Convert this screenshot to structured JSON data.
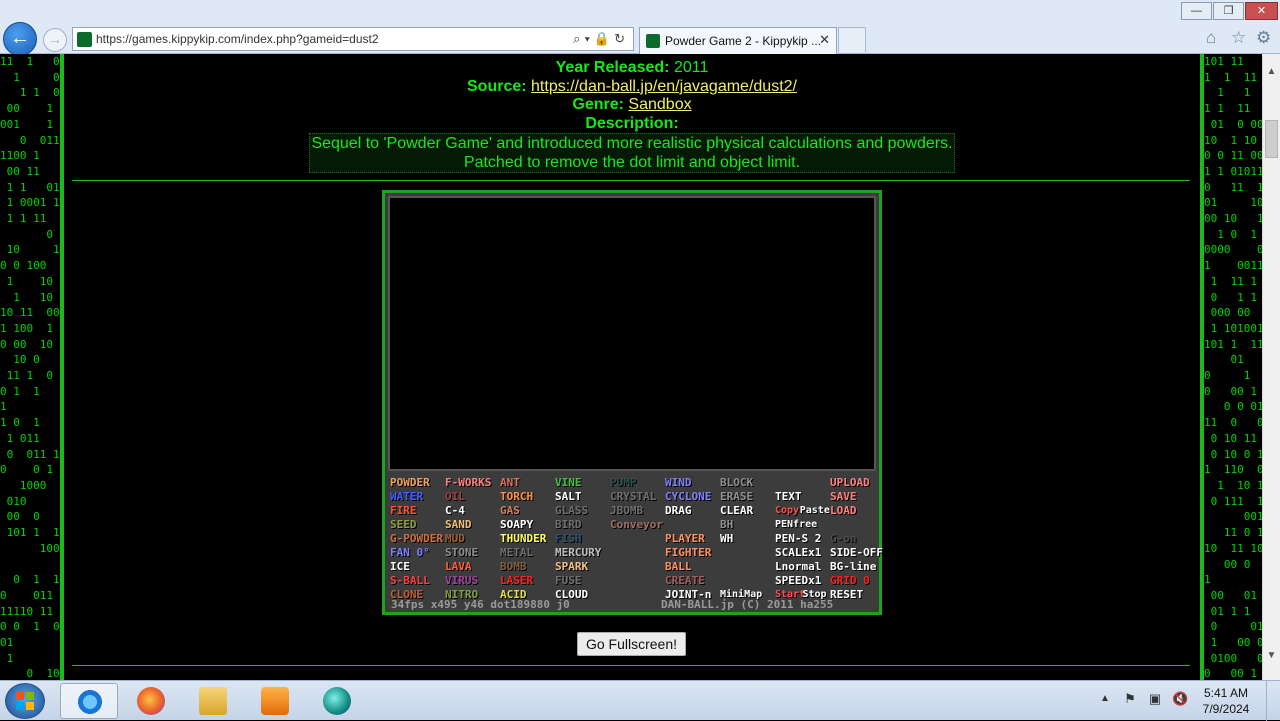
{
  "browser": {
    "url": "https://games.kippykip.com/index.php?gameid=dust2",
    "tab_title": "Powder Game 2 - Kippykip ...",
    "tab_close": "✕",
    "back_glyph": "←",
    "forward_glyph": "→",
    "addr_tools": "⌕▾🔒↻",
    "min_glyph": "—",
    "max_glyph": "❐",
    "close_glyph": "✕",
    "home_glyph": "⌂",
    "star_glyph": "☆",
    "gear_glyph": "⚙"
  },
  "game_info": {
    "year_label": "Year Released:",
    "year_value": "2011",
    "source_label": "Source:",
    "source_url": "https://dan-ball.jp/en/javagame/dust2/",
    "genre_label": "Genre:",
    "genre_value": "Sandbox",
    "description_label": "Description:",
    "description_line1": "Sequel to 'Powder Game' and introduced more realistic physical calculations and powders.",
    "description_line2": "Patched to remove the dot limit and object limit."
  },
  "palette": [
    [
      "POWDER",
      "#f0a060"
    ],
    [
      "F-WORKS",
      "#ff8080"
    ],
    [
      "ANT",
      "#e07060"
    ],
    [
      "VINE",
      "#40c040"
    ],
    [
      "PUMP",
      "#305050"
    ],
    [
      "WIND",
      "#8080ff"
    ],
    [
      "BLOCK",
      "#909090"
    ],
    [
      "UPLOAD",
      "#ff8080"
    ],
    [
      "WATER",
      "#4060ff"
    ],
    [
      "OIL",
      "#a04040"
    ],
    [
      "TORCH",
      "#ff9040"
    ],
    [
      "SALT",
      "#ffffff"
    ],
    [
      "CRYSTAL",
      "#707070"
    ],
    [
      "CYCLONE",
      "#8080ff"
    ],
    [
      "ERASE",
      "#909090"
    ],
    [
      "TEXT",
      "#ffffff"
    ],
    [
      "SAVE",
      "#ff8080"
    ],
    [
      "FIRE",
      "#ff5030"
    ],
    [
      "C-4",
      "#ffffff"
    ],
    [
      "GAS",
      "#d08060"
    ],
    [
      "GLASS",
      "#707070"
    ],
    [
      "JBOMB",
      "#707070"
    ],
    [
      "DRAG",
      "#ffffff"
    ],
    [
      "CLEAR",
      "#ffffff"
    ],
    [
      "Copy",
      "#ff5050"
    ],
    [
      "Paste",
      "#ffffff"
    ],
    [
      "LOAD",
      "#ff8080"
    ],
    [
      "SEED",
      "#90a040"
    ],
    [
      "SAND",
      "#f0c080"
    ],
    [
      "SOAPY",
      "#ffffff"
    ],
    [
      "BIRD",
      "#707070"
    ],
    [
      "Conveyor",
      "#a07060"
    ],
    [
      "BH",
      "#909090"
    ],
    [
      "PENfree",
      "#ffffff"
    ],
    [
      "G-POWDER",
      "#d07040"
    ],
    [
      "MUD",
      "#a06030"
    ],
    [
      "THUNDER",
      "#ffff60"
    ],
    [
      "FISH",
      "#305070"
    ],
    [
      "PLAYER",
      "#ff9060"
    ],
    [
      "WH",
      "#ffffff"
    ],
    [
      "PEN-S 2",
      "#ffffff"
    ],
    [
      "G-on",
      "#505050"
    ],
    [
      "FAN 0°",
      "#8080ff"
    ],
    [
      "STONE",
      "#909090"
    ],
    [
      "METAL",
      "#707070"
    ],
    [
      "MERCURY",
      "#c0c0c0"
    ],
    [
      "FIGHTER",
      "#ff9060"
    ],
    [
      "SCALEx1",
      "#ffffff"
    ],
    [
      "SIDE-OFF",
      "#ffffff"
    ],
    [
      "ICE",
      "#ffffff"
    ],
    [
      "LAVA",
      "#ff6040"
    ],
    [
      "BOMB",
      "#806040"
    ],
    [
      "SPARK",
      "#f0c080"
    ],
    [
      "BALL",
      "#ff9060"
    ],
    [
      "Lnormal",
      "#ffffff"
    ],
    [
      "BG-line",
      "#ffffff"
    ],
    [
      "S-BALL",
      "#ff4040"
    ],
    [
      "VIRUS",
      "#a040a0"
    ],
    [
      "LASER",
      "#ff2020"
    ],
    [
      "FUSE",
      "#707070"
    ],
    [
      "CREATE",
      "#a06060"
    ],
    [
      "SPEEDx1",
      "#ffffff"
    ],
    [
      "GRID 0",
      "#ff2020"
    ],
    [
      "CLONE",
      "#c06030"
    ],
    [
      "NITRO",
      "#80a040"
    ],
    [
      "ACID",
      "#e0e040"
    ],
    [
      "CLOUD",
      "#ffffff"
    ],
    [
      "JOINT-n",
      "#ffffff"
    ],
    [
      "MiniMap",
      "#ffffff"
    ],
    [
      "Start",
      "#ff5050"
    ],
    [
      "Stop",
      "#ffffff"
    ],
    [
      "RESET",
      "#ffffff"
    ]
  ],
  "status": {
    "left": "34fps  x495 y46  dot189880 j0",
    "right": "DAN-BALL.jp (C) 2011 ha255"
  },
  "fullscreen_label": "Go Fullscreen!",
  "taskbar": {
    "time": "5:41 AM",
    "date": "7/9/2024",
    "tray_arrow": "▲",
    "tray_flag": "⚑",
    "tray_net": "▣",
    "tray_vol": "🔇"
  },
  "scrollbar": {
    "up": "▲",
    "down": "▼"
  },
  "colors": {
    "accent_green": "#1cba1c",
    "text_green": "#18e818",
    "link_yellow": "#f0ee6a"
  }
}
